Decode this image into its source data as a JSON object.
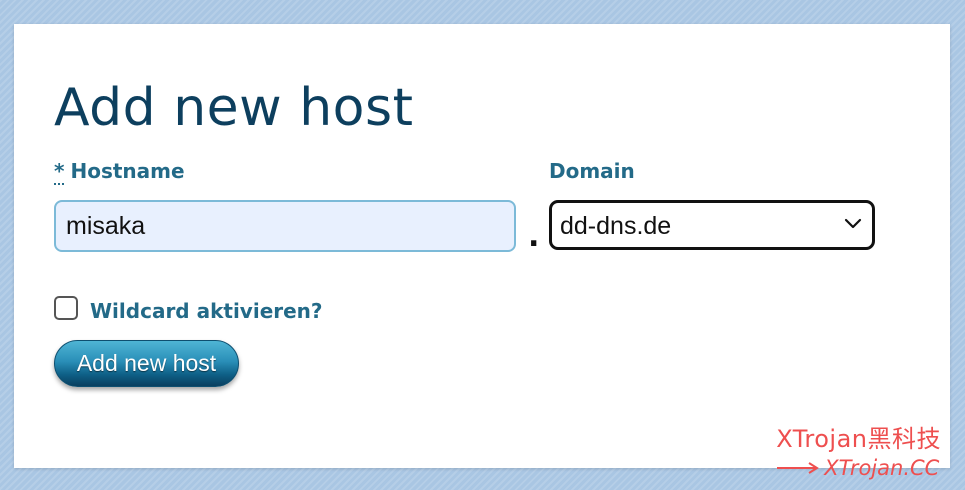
{
  "form": {
    "title": "Add new host",
    "hostname": {
      "required_mark": "*",
      "label": "Hostname",
      "value": "misaka"
    },
    "separator": ".",
    "domain": {
      "label": "Domain",
      "selected": "dd-dns.de"
    },
    "wildcard": {
      "label": "Wildcard aktivieren?",
      "checked": false
    },
    "submit_label": "Add new host"
  },
  "watermark": {
    "title": "XTrojan黑科技",
    "url": "XTrojan.CC"
  },
  "colors": {
    "page_background": "#a9c6e3",
    "title": "#0d3f5e",
    "label": "#236a88",
    "input_background": "#e8f0fe",
    "input_border": "#7cbad8",
    "button_top": "#4fb5d5",
    "button_bottom": "#0a3f5f",
    "watermark": "#ee4f4f"
  }
}
